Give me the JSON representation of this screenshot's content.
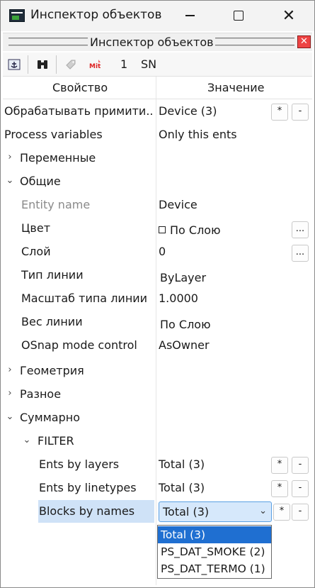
{
  "window": {
    "title": "Инспектор объектов",
    "buttons": {
      "minimize": "minimize",
      "maximize": "maximize",
      "close": "✕"
    }
  },
  "panel": {
    "title": "Инспектор объектов",
    "close": "✕"
  },
  "toolbar": {
    "count": "1",
    "mode": "SN",
    "icons": [
      "anchor-icon",
      "binoculars-icon",
      "tag-icon",
      "mit-icon"
    ]
  },
  "grid": {
    "header": {
      "property": "Свойство",
      "value": "Значение"
    },
    "rows": [
      {
        "name": "Обрабатывать примити...",
        "value": "Device (3)",
        "btn1": "*",
        "btn2": "-"
      },
      {
        "name": "Process variables",
        "value": "Only this ents"
      },
      {
        "name": "Переменные",
        "expander": "›"
      },
      {
        "name": "Общие",
        "expander": "⌄"
      },
      {
        "name": "Entity name",
        "value": "Device"
      },
      {
        "name": "Цвет",
        "value": "По Слою",
        "btn1": "..."
      },
      {
        "name": "Слой",
        "value": "0",
        "btn1": "..."
      },
      {
        "name": "Тип линии",
        "value": "ByLayer"
      },
      {
        "name": "Масштаб типа линии",
        "value": "1.0000"
      },
      {
        "name": "Вес линии",
        "value": "По Слою"
      },
      {
        "name": "OSnap mode control",
        "value": "AsOwner"
      },
      {
        "name": "Геометрия",
        "expander": "›"
      },
      {
        "name": "Разное",
        "expander": "›"
      },
      {
        "name": "Суммарно",
        "expander": "⌄"
      },
      {
        "name": "FILTER",
        "expander": "⌄"
      },
      {
        "name": "Ents by layers",
        "value": "Total (3)",
        "btn1": "*",
        "btn2": "-"
      },
      {
        "name": "Ents by linetypes",
        "value": "Total (3)",
        "btn1": "*",
        "btn2": "-"
      },
      {
        "name": "Blocks by names",
        "value": "Total (3)",
        "btn1": "*",
        "btn2": "-",
        "chevron": "⌄"
      }
    ]
  },
  "dropdown": {
    "options": [
      "Total (3)",
      "PS_DAT_SMOKE (2)",
      "PS_DAT_TERMO (1)"
    ],
    "selected": "Total (3)"
  }
}
